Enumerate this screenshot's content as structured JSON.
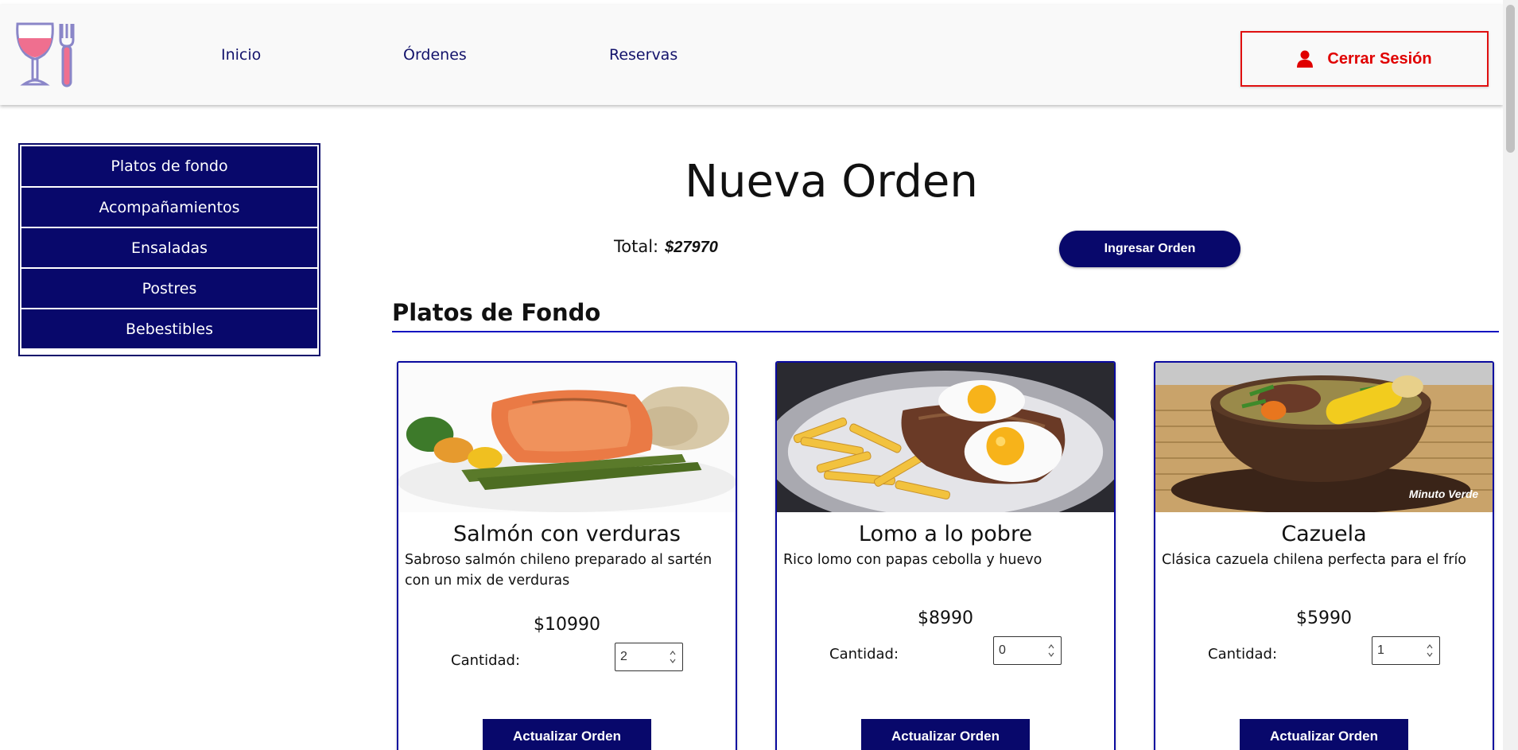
{
  "brand": {
    "logo_icon": "wine-glass-fork-icon",
    "accent": "#08086b",
    "danger": "#e00000"
  },
  "nav": {
    "items": [
      {
        "label": "Inicio"
      },
      {
        "label": "Órdenes"
      },
      {
        "label": "Reservas"
      }
    ],
    "logout_label": "Cerrar Sesión",
    "logout_icon": "user-icon"
  },
  "sidebar": {
    "items": [
      {
        "label": "Platos de fondo"
      },
      {
        "label": "Acompañamientos"
      },
      {
        "label": "Ensaladas"
      },
      {
        "label": "Postres"
      },
      {
        "label": "Bebestibles"
      }
    ]
  },
  "main": {
    "title": "Nueva Orden",
    "total_label": "Total:",
    "total_value": "$27970",
    "submit_label": "Ingresar Orden",
    "section_title": "Platos de Fondo"
  },
  "products": [
    {
      "name": "Salmón con verduras",
      "description": "Sabroso salmón chileno preparado al sartén con un mix de verduras",
      "price": "$10990",
      "qty_label": "Cantidad:",
      "qty": "2",
      "button": "Actualizar Orden",
      "image": "salmon-with-asparagus-photo"
    },
    {
      "name": "Lomo a lo pobre",
      "description": "Rico lomo con papas cebolla y huevo",
      "price": "$8990",
      "qty_label": "Cantidad:",
      "qty": "0",
      "button": "Actualizar Orden",
      "image": "steak-fries-eggs-photo"
    },
    {
      "name": "Cazuela",
      "description": "Clásica cazuela chilena perfecta para el frío",
      "price": "$5990",
      "qty_label": "Cantidad:",
      "qty": "1",
      "button": "Actualizar Orden",
      "image": "cazuela-stew-photo",
      "watermark": "Minuto Verde"
    }
  ]
}
